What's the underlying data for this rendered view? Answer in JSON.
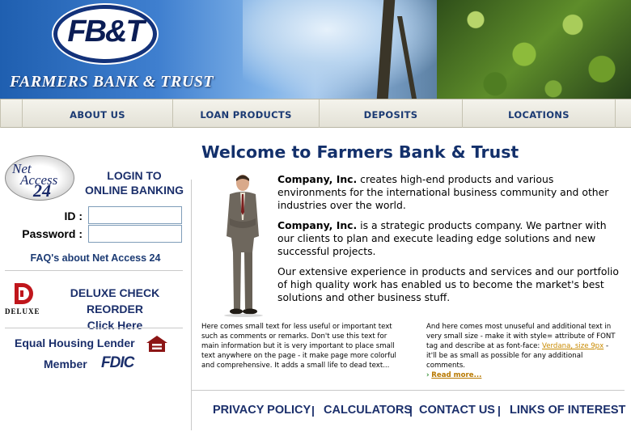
{
  "header": {
    "logo_text": "FB&T",
    "bank_name": "FARMERS BANK & TRUST"
  },
  "nav": {
    "items": [
      {
        "label": "ABOUT US"
      },
      {
        "label": "LOAN PRODUCTS"
      },
      {
        "label": "DEPOSITS"
      },
      {
        "label": "LOCATIONS"
      }
    ]
  },
  "sidebar": {
    "net_access_logo": {
      "line1": "Net",
      "line2": "Access",
      "line3": "24"
    },
    "login_title_line1": "LOGIN TO",
    "login_title_line2": "ONLINE BANKING",
    "id_label": "ID :",
    "password_label": "Password :",
    "id_value": "",
    "password_value": "",
    "faq_link": "FAQ's about Net Access 24",
    "deluxe_word": "DELUXE",
    "check_reorder_line1": "DELUXE CHECK REORDER",
    "check_reorder_line2": "Click Here",
    "equal_housing": "Equal Housing Lender",
    "member": "Member",
    "fdic": "FDIC"
  },
  "main": {
    "welcome": "Welcome to Farmers Bank & Trust",
    "p1_bold": "Company, Inc.",
    "p1_text": " creates high-end products and various environments for the international business community and other industries over the world.",
    "p2_bold": "Company, Inc.",
    "p2_text": " is a strategic products company. We partner with our clients to plan and execute leading edge solutions and new successful projects.",
    "p3_text": "Our extensive experience in products and services and our portfolio of high quality work has enabled us to become the market's best solutions and other business stuff.",
    "small_left": "Here comes small text for less useful or important text such as comments or remarks. Don't use this text for main information but it is very important to place small text anywhere on the page - it make page more colorful and comprehensive. It adds a small life to dead text...",
    "small_right_1": "And here comes most unuseful and additional text in very small size - make it with style= attribute of FONT tag and describe at as font-face: ",
    "small_right_hl": "Verdana, size 9px",
    "small_right_2": " - it'll be as small as possible for any additional comments.",
    "read_more": "Read more..."
  },
  "footer": {
    "links": [
      {
        "label": "PRIVACY POLICY"
      },
      {
        "label": "CALCULATORS"
      },
      {
        "label": "CONTACT US"
      },
      {
        "label": "LINKS OF INTEREST"
      }
    ],
    "separator": "|"
  }
}
